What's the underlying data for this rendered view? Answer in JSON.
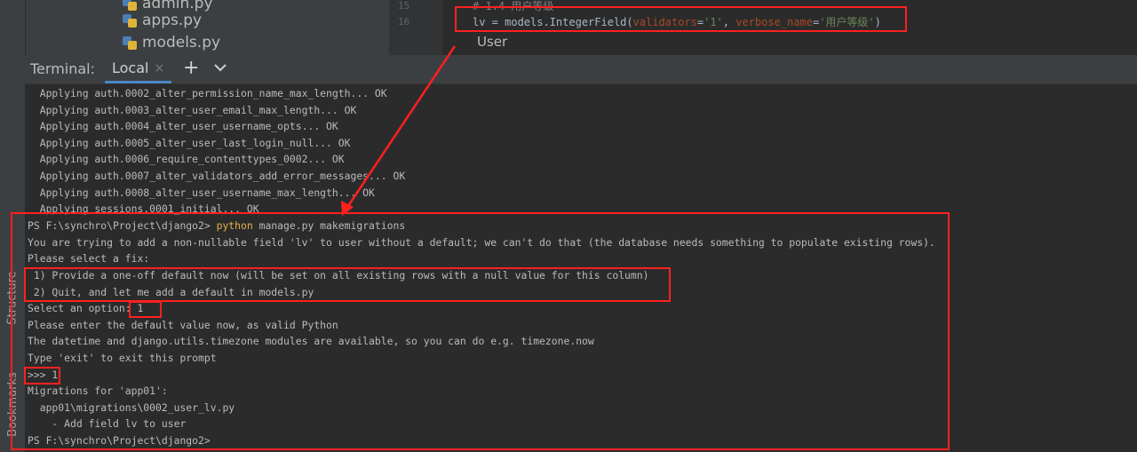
{
  "project_tree": {
    "files": [
      "admin.py",
      "apps.py",
      "models.py"
    ]
  },
  "editor": {
    "line_numbers": [
      "15",
      "16"
    ],
    "comment_line": "# 1.4 用户等级",
    "code_prefix": "lv = models.IntegerField(",
    "param_validators": "validators",
    "val_validators": "'1'",
    "param_verbose": "verbose_name",
    "val_verbose": "'用户等级'",
    "code_suffix": ")",
    "inline_hint": "User"
  },
  "terminal_tabs": {
    "title": "Terminal:",
    "active_tab": "Local",
    "close_glyph": "×",
    "add_glyph": "+"
  },
  "side_panels": {
    "structure": "Structure",
    "bookmarks": "Bookmarks"
  },
  "terminal": {
    "migration_lines": [
      "  Applying auth.0002_alter_permission_name_max_length... OK",
      "  Applying auth.0003_alter_user_email_max_length... OK",
      "  Applying auth.0004_alter_user_username_opts... OK",
      "  Applying auth.0005_alter_user_last_login_null... OK",
      "  Applying auth.0006_require_contenttypes_0002... OK",
      "  Applying auth.0007_alter_validators_add_error_messages... OK",
      "  Applying auth.0008_alter_user_username_max_length... OK",
      "  Applying sessions.0001_initial... OK"
    ],
    "prompt": "PS F:\\synchro\\Project\\django2> ",
    "command_python": "python",
    "command_rest": " manage.py makemigrations",
    "output_lines": [
      "You are trying to add a non-nullable field 'lv' to user without a default; we can't do that (the database needs something to populate existing rows).",
      "Please select a fix:",
      " 1) Provide a one-off default now (will be set on all existing rows with a null value for this column)",
      " 2) Quit, and let me add a default in models.py",
      "Select an option: 1",
      "Please enter the default value now, as valid Python",
      "The datetime and django.utils.timezone modules are available, so you can do e.g. timezone.now",
      "Type 'exit' to exit this prompt",
      ">>> 1",
      "Migrations for 'app01':",
      "  app01\\migrations\\0002_user_lv.py",
      "    - Add field lv to user",
      "PS F:\\synchro\\Project\\django2>"
    ]
  },
  "colors": {
    "annotation_red": "#ff2020",
    "command_yellow": "#e3b24a",
    "tab_underline": "#4a88c7"
  }
}
